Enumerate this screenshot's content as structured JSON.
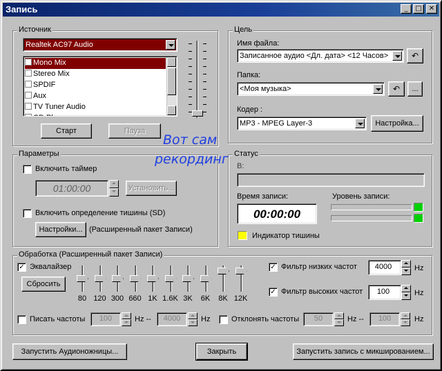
{
  "window": {
    "title": "Запись"
  },
  "source": {
    "legend": "Источник",
    "device": "Realtek AC97 Audio",
    "inputs": [
      {
        "label": "Mono Mix",
        "selected": true
      },
      {
        "label": "Stereo Mix",
        "selected": false
      },
      {
        "label": "SPDIF",
        "selected": false
      },
      {
        "label": "Aux",
        "selected": false
      },
      {
        "label": "TV Tuner Audio",
        "selected": false
      },
      {
        "label": "CD Player",
        "selected": false
      }
    ],
    "start_label": "Старт",
    "pause_label": "Пауза"
  },
  "target": {
    "legend": "Цель",
    "filename_label": "Имя файла:",
    "filename_value": "Записанное аудио <Дл. дата> <12 Часов>",
    "folder_label": "Папка:",
    "folder_value": "<Моя музыка>",
    "folder_more_label": "...",
    "codec_label": "Кодер :",
    "codec_value": "MP3 - MPEG Layer-3",
    "codec_settings_label": "Настройка..."
  },
  "params": {
    "legend": "Параметры",
    "timer_label": "Включить таймер",
    "timer_value": "01:00:00",
    "set_label": "Установить...",
    "silence_label": "Включить определение тишины (SD)",
    "settings_label": "Настройки...",
    "settings_note": "(Расширенный пакет Записи)"
  },
  "watermark": {
    "line1": "Вот сам",
    "line2": "рекординг"
  },
  "status": {
    "legend": "Статус",
    "in_label": "В:",
    "time_label": "Время записи:",
    "time_value": "00:00:00",
    "level_label": "Уровень записи:",
    "silence_indicator_label": "Индикатор тишины",
    "silence_color": "#ffff00",
    "led_color": "#00d000"
  },
  "processing": {
    "legend": "Обработка (Расширенный пакет Записи)",
    "eq_label": "Эквалайзер",
    "reset_label": "Сбросить",
    "bands": [
      {
        "label": "80",
        "level": 0.5
      },
      {
        "label": "120",
        "level": 0.5
      },
      {
        "label": "300",
        "level": 0.5
      },
      {
        "label": "660",
        "level": 0.5
      },
      {
        "label": "1K",
        "level": 0.5
      },
      {
        "label": "1.6K",
        "level": 0.5
      },
      {
        "label": "3K",
        "level": 0.5
      },
      {
        "label": "6K",
        "level": 0.5
      },
      {
        "label": "8K",
        "level": 0.9
      },
      {
        "label": "12K",
        "level": 0.9
      }
    ],
    "lowpass_label": "Фильтр низких частот",
    "lowpass_value": "4000",
    "highpass_label": "Фильтр высоких частот",
    "highpass_value": "100",
    "hz": "Hz",
    "write_freq_label": "Писать частоты",
    "write_from": "100",
    "write_to": "4000",
    "reject_freq_label": "Отклонять частоты",
    "reject_from": "50",
    "reject_to": "100",
    "range_sep": "Hz --"
  },
  "footer": {
    "mixer_label": "Запустить Аудионожницы...",
    "close_label": "Закрыть",
    "record_mix_label": "Запустить запись с микшированием..."
  }
}
